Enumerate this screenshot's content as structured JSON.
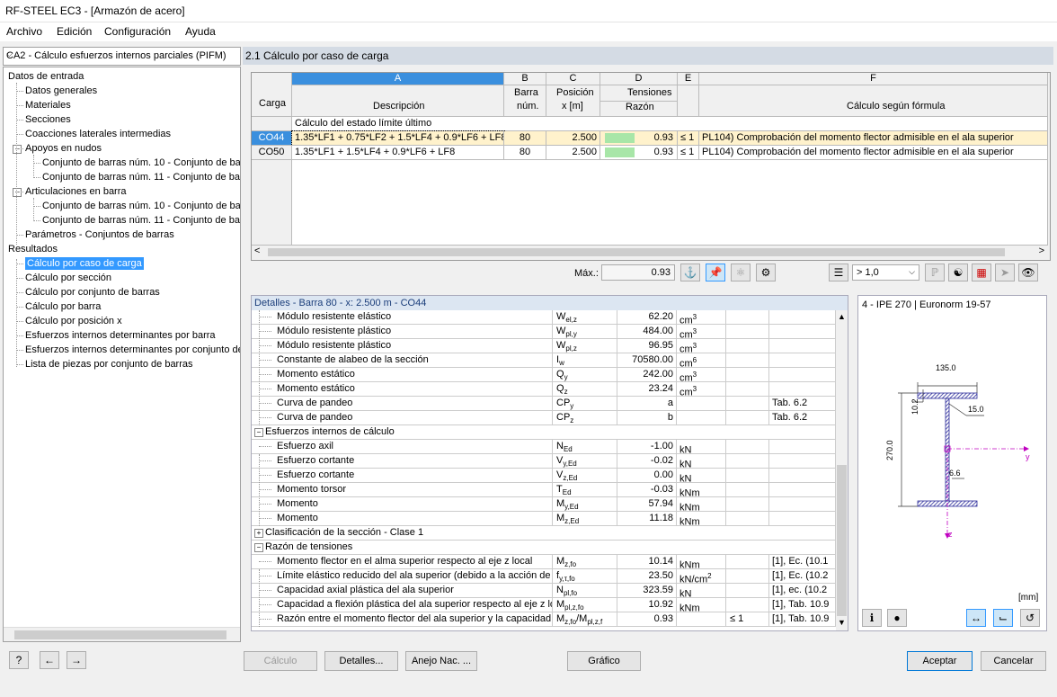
{
  "window_title": "RF-STEEL EC3 - [Armazón de acero]",
  "menu": [
    "Archivo",
    "Edición",
    "Configuración",
    "Ayuda"
  ],
  "case_selector": "CA2 - Cálculo esfuerzos internos parciales (PIFM)",
  "tree": {
    "items": [
      {
        "label": "Datos de entrada",
        "level": 0
      },
      {
        "label": "Datos generales",
        "level": 1
      },
      {
        "label": "Materiales",
        "level": 1
      },
      {
        "label": "Secciones",
        "level": 1
      },
      {
        "label": "Coacciones laterales intermedias",
        "level": 1
      },
      {
        "label": "Apoyos en nudos",
        "level": 1
      },
      {
        "label": "Conjunto de barras núm. 10 - Conjunto de ba",
        "level": 2
      },
      {
        "label": "Conjunto de barras núm. 11 - Conjunto de ba",
        "level": 2
      },
      {
        "label": "Articulaciones en barra",
        "level": 1
      },
      {
        "label": "Conjunto de barras núm. 10 - Conjunto de ba",
        "level": 2
      },
      {
        "label": "Conjunto de barras núm. 11 - Conjunto de ba",
        "level": 2
      },
      {
        "label": "Parámetros - Conjuntos de barras",
        "level": 1
      },
      {
        "label": "Resultados",
        "level": 0
      },
      {
        "label": "Cálculo por caso de carga",
        "level": 1
      },
      {
        "label": "Cálculo por sección",
        "level": 1
      },
      {
        "label": "Cálculo por conjunto de barras",
        "level": 1
      },
      {
        "label": "Cálculo por barra",
        "level": 1
      },
      {
        "label": "Cálculo por posición x",
        "level": 1
      },
      {
        "label": "Esfuerzos internos determinantes por barra",
        "level": 1
      },
      {
        "label": "Esfuerzos internos determinantes por conjunto de",
        "level": 1
      },
      {
        "label": "Lista de piezas por conjunto de barras",
        "level": 1
      }
    ]
  },
  "section_title": "2.1 Cálculo por caso de carga",
  "grid": {
    "col_letters": [
      "A",
      "B",
      "C",
      "D",
      "E",
      "F"
    ],
    "carga_header": "Carga",
    "headers": {
      "a": "Descripción",
      "b1": "Barra",
      "b2": "núm.",
      "c1": "Posición",
      "c2": "x [m]",
      "d1": "Tensiones",
      "d2": "Razón",
      "f": "Cálculo según fórmula"
    },
    "group_label": "Cálculo del estado límite último",
    "rows": [
      {
        "carga": "CO44",
        "desc": "1.35*LF1 + 0.75*LF2 + 1.5*LF4 + 0.9*LF6 + LF8",
        "barra": "80",
        "pos": "2.500",
        "ratio": "0.93",
        "le": "≤ 1",
        "formula": "PL104) Comprobación del momento flector admisible en el ala superior",
        "selected": true
      },
      {
        "carga": "CO50",
        "desc": "1.35*LF1 + 1.5*LF4 + 0.9*LF6 + LF8",
        "barra": "80",
        "pos": "2.500",
        "ratio": "0.93",
        "le": "≤ 1",
        "formula": "PL104) Comprobación del momento flector admisible en el ala superior",
        "selected": false
      }
    ],
    "ratio_fill": 0.93,
    "max_label": "Máx.:",
    "max_value": "0.93",
    "filter_value": "> 1,0"
  },
  "details": {
    "title": "Detalles - Barra 80 - x: 2.500 m - CO44",
    "rows": [
      {
        "type": "row",
        "name": "Módulo resistente elástico",
        "sym": "W",
        "sub": "el,z",
        "val": "62.20",
        "unit": "cm",
        "sup": "3",
        "ref": ""
      },
      {
        "type": "row",
        "name": "Módulo resistente plástico",
        "sym": "W",
        "sub": "pl,y",
        "val": "484.00",
        "unit": "cm",
        "sup": "3",
        "ref": ""
      },
      {
        "type": "row",
        "name": "Módulo resistente plástico",
        "sym": "W",
        "sub": "pl,z",
        "val": "96.95",
        "unit": "cm",
        "sup": "3",
        "ref": ""
      },
      {
        "type": "row",
        "name": "Constante de alabeo de la sección",
        "sym": "I",
        "sub": "w",
        "val": "70580.00",
        "unit": "cm",
        "sup": "6",
        "ref": ""
      },
      {
        "type": "row",
        "name": "Momento estático",
        "sym": "Q",
        "sub": "y",
        "val": "242.00",
        "unit": "cm",
        "sup": "3",
        "ref": ""
      },
      {
        "type": "row",
        "name": "Momento estático",
        "sym": "Q",
        "sub": "z",
        "val": "23.24",
        "unit": "cm",
        "sup": "3",
        "ref": ""
      },
      {
        "type": "row",
        "name": "Curva de pandeo",
        "sym": "CP",
        "sub": "y",
        "val": "a",
        "unit": "",
        "sup": "",
        "ref": "Tab. 6.2"
      },
      {
        "type": "row",
        "name": "Curva de pandeo",
        "sym": "CP",
        "sub": "z",
        "val": "b",
        "unit": "",
        "sup": "",
        "ref": "Tab. 6.2"
      },
      {
        "type": "section",
        "name": "Esfuerzos internos de cálculo",
        "sign": "−"
      },
      {
        "type": "row",
        "name": "Esfuerzo axil",
        "sym": "N",
        "sub": "Ed",
        "val": "-1.00",
        "unit": "kN",
        "sup": "",
        "ref": ""
      },
      {
        "type": "row",
        "name": "Esfuerzo cortante",
        "sym": "V",
        "sub": "y,Ed",
        "val": "-0.02",
        "unit": "kN",
        "sup": "",
        "ref": ""
      },
      {
        "type": "row",
        "name": "Esfuerzo cortante",
        "sym": "V",
        "sub": "z,Ed",
        "val": "0.00",
        "unit": "kN",
        "sup": "",
        "ref": ""
      },
      {
        "type": "row",
        "name": "Momento torsor",
        "sym": "T",
        "sub": "Ed",
        "val": "-0.03",
        "unit": "kNm",
        "sup": "",
        "ref": ""
      },
      {
        "type": "row",
        "name": "Momento",
        "sym": "M",
        "sub": "y,Ed",
        "val": "57.94",
        "unit": "kNm",
        "sup": "",
        "ref": ""
      },
      {
        "type": "row",
        "name": "Momento",
        "sym": "M",
        "sub": "z,Ed",
        "val": "11.18",
        "unit": "kNm",
        "sup": "",
        "ref": ""
      },
      {
        "type": "section",
        "name": "Clasificación de la sección - Clase 1",
        "sign": "+"
      },
      {
        "type": "section",
        "name": "Razón de tensiones",
        "sign": "−"
      },
      {
        "type": "row",
        "name": "Momento flector en el alma superior respecto al eje z local",
        "sym": "M",
        "sub": "z,fo",
        "val": "10.14",
        "unit": "kNm",
        "sup": "",
        "ref": "[1], Ec. (10.1"
      },
      {
        "type": "row",
        "name": "Límite elástico reducido del ala superior (debido a la acción de co",
        "sym": "f",
        "sub": "y,τ,fo",
        "val": "23.50",
        "unit": "kN/cm",
        "sup": "2",
        "ref": "[1], Ec. (10.2"
      },
      {
        "type": "row",
        "name": "Capacidad axial plástica del ala superior",
        "sym": "N",
        "sub": "pl,fo",
        "val": "323.59",
        "unit": "kN",
        "sup": "",
        "ref": "[1], ec. (10.2"
      },
      {
        "type": "row",
        "name": "Capacidad a flexión plástica del ala superior respecto al eje z loca",
        "sym": "M",
        "sub": "pl,z,fo",
        "val": "10.92",
        "unit": "kNm",
        "sup": "",
        "ref": "[1], Tab. 10.9"
      },
      {
        "type": "row",
        "name": "Razón entre el momento flector del ala superior y la capacidad a",
        "sym": "M",
        "sub": "z,fo",
        "sym2": "/M",
        "sub2": "pl,z,f",
        "val": "0.93",
        "unit": "",
        "sup": "",
        "le": "≤ 1",
        "ref": "[1], Tab. 10.9"
      }
    ]
  },
  "preview": {
    "title": "4 - IPE 270 | Euronorm 19-57",
    "dims": {
      "b": "135.0",
      "h": "270.0",
      "tf": "10.2",
      "r": "15.0",
      "tw": "6.6"
    },
    "axis_y": "y",
    "axis_z": "z",
    "unit": "[mm]"
  },
  "buttons": {
    "calc": "Cálculo",
    "details": "Detalles...",
    "annex": "Anejo Nac. ...",
    "graphic": "Gráfico",
    "accept": "Aceptar",
    "cancel": "Cancelar"
  },
  "colors": {
    "accent": "#3a8fde",
    "ratio_bar": "#a8e6a8",
    "selected_bg": "#fff2cc",
    "profile": "#2b2b9a",
    "axis": "#c000c0"
  }
}
